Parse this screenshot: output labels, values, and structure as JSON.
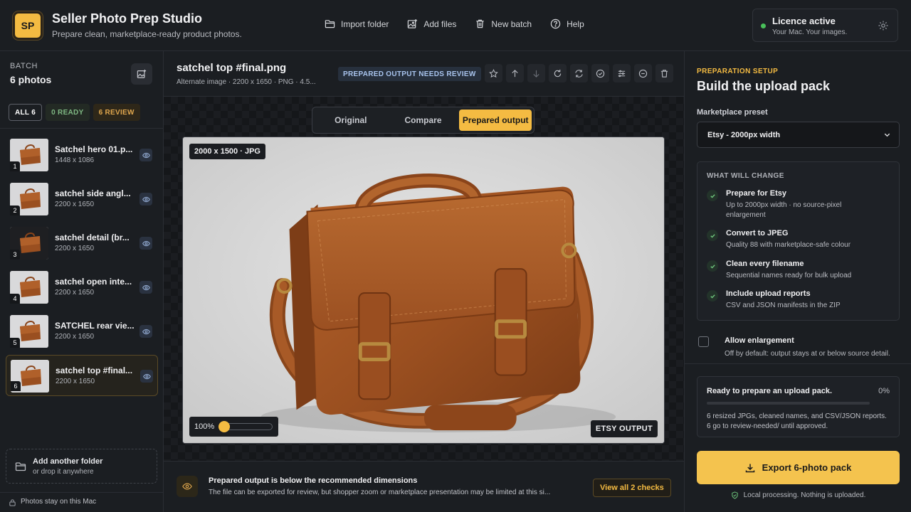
{
  "app": {
    "logo": "SP",
    "title": "Seller Photo Prep Studio",
    "subtitle": "Prepare clean, marketplace-ready product photos."
  },
  "header": {
    "actions": [
      {
        "label": "Import folder",
        "icon": "folder-icon"
      },
      {
        "label": "Add files",
        "icon": "add-image-icon"
      },
      {
        "label": "New batch",
        "icon": "trash-icon"
      },
      {
        "label": "Help",
        "icon": "help-icon"
      }
    ],
    "licence": {
      "title": "Licence active",
      "subtitle": "Your Mac. Your images.",
      "status_color": "#49c05a"
    }
  },
  "sidebar": {
    "batch_label": "BATCH",
    "batch_count": "6 photos",
    "filters": {
      "all": "ALL 6",
      "ready": "0 READY",
      "review": "6 REVIEW"
    },
    "files": [
      {
        "num": "1",
        "name": "Satchel hero 01.p...",
        "dims": "1448 x 1086"
      },
      {
        "num": "2",
        "name": "satchel side angl...",
        "dims": "2200 x 1650"
      },
      {
        "num": "3",
        "name": "satchel detail (br...",
        "dims": "2200 x 1650"
      },
      {
        "num": "4",
        "name": "satchel open inte...",
        "dims": "2200 x 1650"
      },
      {
        "num": "5",
        "name": "SATCHEL rear vie...",
        "dims": "2200 x 1650"
      },
      {
        "num": "6",
        "name": "satchel top #final...",
        "dims": "2200 x 1650"
      }
    ],
    "active_index": 5,
    "add_folder": {
      "title": "Add another folder",
      "subtitle": "or drop it anywhere"
    },
    "footer": "Photos stay on this Mac"
  },
  "main": {
    "title": "satchel top #final.png",
    "meta": "Alternate image · 2200 x 1650 · PNG · 4.5...",
    "status_badge": "PREPARED OUTPUT NEEDS REVIEW",
    "tabs": [
      "Original",
      "Compare",
      "Prepared output"
    ],
    "active_tab": 2,
    "tag": "2000 x 1500 · JPG",
    "output_badge": "ETSY OUTPUT",
    "zoom": "100%",
    "zoom_level": 0.0,
    "notice": {
      "title": "Prepared output is below the recommended dimensions",
      "subtitle": "The file can be exported for review, but shopper zoom or marketplace presentation may be limited at this si...",
      "button": "View all 2 checks"
    }
  },
  "panel": {
    "eyebrow": "PREPARATION SETUP",
    "title": "Build the upload pack",
    "preset_label": "Marketplace preset",
    "preset_value": "Etsy - 2000px width",
    "changes_heading": "WHAT WILL CHANGE",
    "changes": [
      {
        "title": "Prepare for Etsy",
        "subtitle": "Up to 2000px width · no source-pixel enlargement"
      },
      {
        "title": "Convert to JPEG",
        "subtitle": "Quality 88 with marketplace-safe colour"
      },
      {
        "title": "Clean every filename",
        "subtitle": "Sequential names ready for bulk upload"
      },
      {
        "title": "Include upload reports",
        "subtitle": "CSV and JSON manifests in the ZIP"
      }
    ],
    "enlarge": {
      "title": "Allow enlargement",
      "subtitle": "Off by default: output stays at or below source detail."
    },
    "ready": {
      "title": "Ready to prepare an upload pack.",
      "percent": "0%",
      "progress": 0,
      "subtitle": "6 resized JPGs, cleaned names, and CSV/JSON reports. 6 go to review-needed/ until approved."
    },
    "export_label": "Export 6-photo pack",
    "local_note": "Local processing. Nothing is uploaded."
  },
  "colors": {
    "accent": "#f4bb42",
    "success": "#6cc17a",
    "review": "#e0a74e",
    "info": "#a9c4ee"
  }
}
